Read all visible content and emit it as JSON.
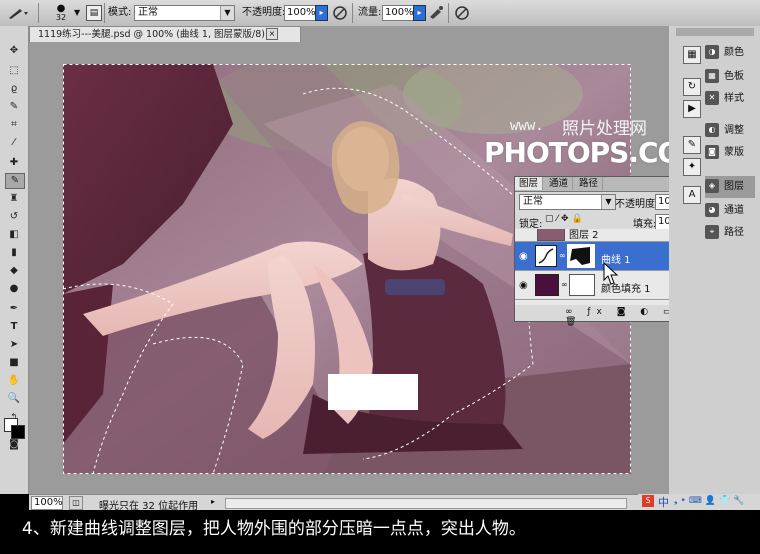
{
  "options_bar": {
    "brush_size": "32",
    "mode_label": "模式:",
    "mode_value": "正常",
    "opacity_label": "不透明度:",
    "opacity_value": "100%",
    "flow_label": "流量:",
    "flow_value": "100%"
  },
  "document": {
    "tab_title": "1119练习---美腿.psd @ 100% (曲线 1, 图层蒙版/8) *",
    "close_glyph": "×",
    "zoom": "100%",
    "status_text": "曝光只在 32 位起作用"
  },
  "watermark": {
    "line1": "www.",
    "line1_cn": "照片处理网",
    "line2": "PHOTOPS.COM"
  },
  "layers_panel": {
    "tabs": [
      "图层",
      "通道",
      "路径"
    ],
    "blend_mode": "正常",
    "opacity_label": "不透明度:",
    "opacity_value": "100%",
    "lock_label": "锁定:",
    "fill_label": "填充:",
    "fill_value": "100%",
    "layers": [
      {
        "name": "图层 2",
        "selected": false
      },
      {
        "name": "曲线 1",
        "selected": true
      },
      {
        "name": "颜色填充 1",
        "selected": false
      }
    ]
  },
  "dock": {
    "items": [
      {
        "label": "颜色",
        "icon": "color-icon"
      },
      {
        "label": "色板",
        "icon": "swatches-icon"
      },
      {
        "label": "样式",
        "icon": "styles-icon"
      },
      {
        "label": "调整",
        "icon": "adjustments-icon"
      },
      {
        "label": "蒙版",
        "icon": "masks-icon"
      },
      {
        "label": "图层",
        "icon": "layers-icon"
      },
      {
        "label": "通道",
        "icon": "channels-icon"
      },
      {
        "label": "路径",
        "icon": "paths-icon"
      }
    ]
  },
  "taskbar": {
    "ime": "中"
  },
  "caption": "4、新建曲线调整图层，把人物外围的部分压暗一点点，突出人物。",
  "colors": {
    "accent": "#2f6fd6",
    "selected_layer": "#3a6fd0",
    "canvas_purple": "#7a4a66"
  }
}
